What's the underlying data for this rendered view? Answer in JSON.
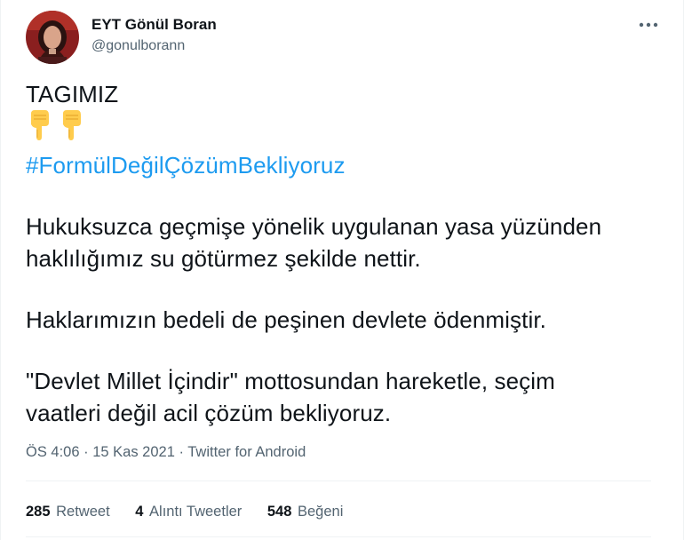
{
  "author": {
    "display_name": "EYT Gönül Boran",
    "handle": "@gonulborann"
  },
  "menu": {
    "icon": "more-horizontal-icon"
  },
  "tweet": {
    "line1": "TAGIMIZ",
    "emojis": [
      "backhand-index-pointing-down",
      "backhand-index-pointing-down"
    ],
    "hashtag": "#FormülDeğilÇözümBekliyoruz",
    "p1_line1": "Hukuksuzca geçmişe yönelik uygulanan yasa yüzünden",
    "p1_line2": "haklılığımız su götürmez şekilde nettir.",
    "p2_line1": "Haklarımızın bedeli de peşinen devlete ödenmiştir.",
    "p3_line1": "\"Devlet Millet İçindir\" mottosundan hareketle, seçim",
    "p3_line2": "vaatleri değil acil çözüm bekliyoruz."
  },
  "meta": {
    "time": "ÖS 4:06",
    "separator": " · ",
    "date": "15 Kas 2021",
    "source": "Twitter for Android"
  },
  "stats": {
    "retweets_count": "285",
    "retweets_label": "Retweet",
    "quotes_count": "4",
    "quotes_label": "Alıntı Tweetler",
    "likes_count": "548",
    "likes_label": "Beğeni"
  },
  "colors": {
    "link": "#1d9bf0",
    "secondary_text": "#536471",
    "primary_text": "#0f1419",
    "divider": "#eff3f4"
  }
}
